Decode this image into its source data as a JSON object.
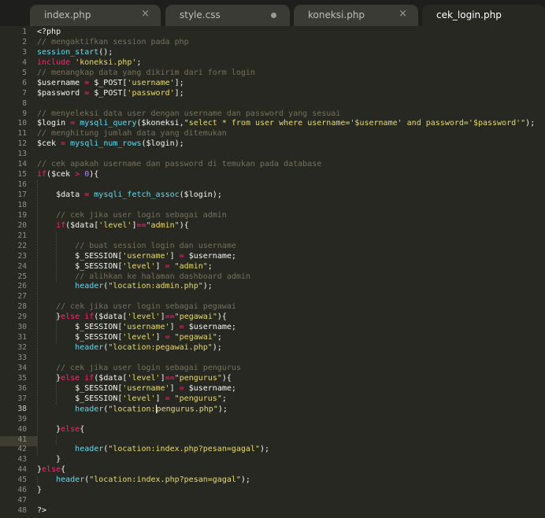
{
  "tabs": [
    {
      "label": "index.php",
      "active": false,
      "dirty": false
    },
    {
      "label": "style.css",
      "active": false,
      "dirty": true
    },
    {
      "label": "koneksi.php",
      "active": false,
      "dirty": false
    },
    {
      "label": "cek_login.php",
      "active": true,
      "dirty": false
    }
  ],
  "close_glyph": "×",
  "current_line": 38,
  "lines": [
    [
      [
        "plain",
        "<?php"
      ]
    ],
    [
      [
        "comment",
        "// mengaktifkan session pada php"
      ]
    ],
    [
      [
        "func",
        "session_start"
      ],
      [
        "plain",
        "();"
      ]
    ],
    [
      [
        "keyword",
        "include"
      ],
      [
        "plain",
        " "
      ],
      [
        "string",
        "'koneksi.php'"
      ],
      [
        "plain",
        ";"
      ]
    ],
    [
      [
        "comment",
        "// menangkap data yang dikirim dari form login"
      ]
    ],
    [
      [
        "plain",
        "$username "
      ],
      [
        "keyword",
        "="
      ],
      [
        "plain",
        " $_POST["
      ],
      [
        "string",
        "'username'"
      ],
      [
        "plain",
        "];"
      ]
    ],
    [
      [
        "plain",
        "$password "
      ],
      [
        "keyword",
        "="
      ],
      [
        "plain",
        " $_POST["
      ],
      [
        "string",
        "'password'"
      ],
      [
        "plain",
        "];"
      ]
    ],
    [],
    [
      [
        "comment",
        "// menyeleksi data user dengan username dan password yang sesuai"
      ]
    ],
    [
      [
        "plain",
        "$login "
      ],
      [
        "keyword",
        "="
      ],
      [
        "plain",
        " "
      ],
      [
        "func",
        "mysqli_query"
      ],
      [
        "plain",
        "($koneksi,"
      ],
      [
        "string",
        "\"select * from user where username='$username' and password='$password'\""
      ],
      [
        "plain",
        ");"
      ]
    ],
    [
      [
        "comment",
        "// menghitung jumlah data yang ditemukan"
      ]
    ],
    [
      [
        "plain",
        "$cek "
      ],
      [
        "keyword",
        "="
      ],
      [
        "plain",
        " "
      ],
      [
        "func",
        "mysqli_num_rows"
      ],
      [
        "plain",
        "($login);"
      ]
    ],
    [],
    [
      [
        "comment",
        "// cek apakah username dan password di temukan pada database"
      ]
    ],
    [
      [
        "keyword",
        "if"
      ],
      [
        "plain",
        "($cek "
      ],
      [
        "keyword",
        ">"
      ],
      [
        "plain",
        " "
      ],
      [
        "number",
        "0"
      ],
      [
        "plain",
        "){"
      ]
    ],
    [],
    [
      [
        "plain",
        "    $data "
      ],
      [
        "keyword",
        "="
      ],
      [
        "plain",
        " "
      ],
      [
        "func",
        "mysqli_fetch_assoc"
      ],
      [
        "plain",
        "($login);"
      ]
    ],
    [],
    [
      [
        "plain",
        "    "
      ],
      [
        "comment",
        "// cek jika user login sebagai admin"
      ]
    ],
    [
      [
        "plain",
        "    "
      ],
      [
        "keyword",
        "if"
      ],
      [
        "plain",
        "($data["
      ],
      [
        "string",
        "'level'"
      ],
      [
        "plain",
        "]"
      ],
      [
        "keyword",
        "=="
      ],
      [
        "string",
        "\"admin\""
      ],
      [
        "plain",
        "){"
      ]
    ],
    [],
    [
      [
        "plain",
        "        "
      ],
      [
        "comment",
        "// buat session login dan username"
      ]
    ],
    [
      [
        "plain",
        "        $_SESSION["
      ],
      [
        "string",
        "'username'"
      ],
      [
        "plain",
        "] "
      ],
      [
        "keyword",
        "="
      ],
      [
        "plain",
        " $username;"
      ]
    ],
    [
      [
        "plain",
        "        $_SESSION["
      ],
      [
        "string",
        "'level'"
      ],
      [
        "plain",
        "] "
      ],
      [
        "keyword",
        "="
      ],
      [
        "plain",
        " "
      ],
      [
        "string",
        "\"admin\""
      ],
      [
        "plain",
        ";"
      ]
    ],
    [
      [
        "plain",
        "        "
      ],
      [
        "comment",
        "// alihkan ke halaman dashboard admin"
      ]
    ],
    [
      [
        "plain",
        "        "
      ],
      [
        "func",
        "header"
      ],
      [
        "plain",
        "("
      ],
      [
        "string",
        "\"location:admin.php\""
      ],
      [
        "plain",
        ");"
      ]
    ],
    [],
    [
      [
        "plain",
        "    "
      ],
      [
        "comment",
        "// cek jika user login sebagai pegawai"
      ]
    ],
    [
      [
        "plain",
        "    }"
      ],
      [
        "keyword",
        "else"
      ],
      [
        "plain",
        " "
      ],
      [
        "keyword",
        "if"
      ],
      [
        "plain",
        "($data["
      ],
      [
        "string",
        "'level'"
      ],
      [
        "plain",
        "]"
      ],
      [
        "keyword",
        "=="
      ],
      [
        "string",
        "\"pegawai\""
      ],
      [
        "plain",
        "){"
      ]
    ],
    [
      [
        "plain",
        "        $_SESSION["
      ],
      [
        "string",
        "'username'"
      ],
      [
        "plain",
        "] "
      ],
      [
        "keyword",
        "="
      ],
      [
        "plain",
        " $username;"
      ]
    ],
    [
      [
        "plain",
        "        $_SESSION["
      ],
      [
        "string",
        "'level'"
      ],
      [
        "plain",
        "] "
      ],
      [
        "keyword",
        "="
      ],
      [
        "plain",
        " "
      ],
      [
        "string",
        "\"pegawai\""
      ],
      [
        "plain",
        ";"
      ]
    ],
    [
      [
        "plain",
        "        "
      ],
      [
        "func",
        "header"
      ],
      [
        "plain",
        "("
      ],
      [
        "string",
        "\"location:pegawai.php\""
      ],
      [
        "plain",
        ");"
      ]
    ],
    [],
    [
      [
        "plain",
        "    "
      ],
      [
        "comment",
        "// cek jika user login sebagai pengurus"
      ]
    ],
    [
      [
        "plain",
        "    }"
      ],
      [
        "keyword",
        "else"
      ],
      [
        "plain",
        " "
      ],
      [
        "keyword",
        "if"
      ],
      [
        "plain",
        "($data["
      ],
      [
        "string",
        "'level'"
      ],
      [
        "plain",
        "]"
      ],
      [
        "keyword",
        "=="
      ],
      [
        "string",
        "\"pengurus\""
      ],
      [
        "plain",
        "){"
      ]
    ],
    [
      [
        "plain",
        "        $_SESSION["
      ],
      [
        "string",
        "'username'"
      ],
      [
        "plain",
        "] "
      ],
      [
        "keyword",
        "="
      ],
      [
        "plain",
        " $username;"
      ]
    ],
    [
      [
        "plain",
        "        $_SESSION["
      ],
      [
        "string",
        "'level'"
      ],
      [
        "plain",
        "] "
      ],
      [
        "keyword",
        "="
      ],
      [
        "plain",
        " "
      ],
      [
        "string",
        "\"pengurus\""
      ],
      [
        "plain",
        ";"
      ]
    ],
    [
      [
        "plain",
        "        "
      ],
      [
        "func",
        "header"
      ],
      [
        "plain",
        "("
      ],
      [
        "string",
        "\"location:"
      ],
      [
        "caret",
        ""
      ],
      [
        "string",
        "pengurus.php\""
      ],
      [
        "plain",
        ");"
      ]
    ],
    [],
    [
      [
        "plain",
        "    }"
      ],
      [
        "keyword",
        "else"
      ],
      [
        "plain",
        "{"
      ]
    ],
    [],
    [
      [
        "plain",
        "        "
      ],
      [
        "func",
        "header"
      ],
      [
        "plain",
        "("
      ],
      [
        "string",
        "\"location:index.php?pesan=gagal\""
      ],
      [
        "plain",
        ");"
      ]
    ],
    [
      [
        "plain",
        "    }"
      ]
    ],
    [
      [
        "plain",
        "}"
      ],
      [
        "keyword",
        "else"
      ],
      [
        "plain",
        "{"
      ]
    ],
    [
      [
        "plain",
        "    "
      ],
      [
        "func",
        "header"
      ],
      [
        "plain",
        "("
      ],
      [
        "string",
        "\"location:index.php?pesan=gagal\""
      ],
      [
        "plain",
        ");"
      ]
    ],
    [
      [
        "plain",
        "}"
      ]
    ],
    [],
    [
      [
        "plain",
        "?>"
      ]
    ]
  ],
  "colors": {
    "background": "#272822",
    "comment": "#75715e",
    "keyword": "#f92672",
    "function": "#66d9ef",
    "string": "#e6db74",
    "number": "#ae81ff",
    "text": "#f8f8f2"
  }
}
